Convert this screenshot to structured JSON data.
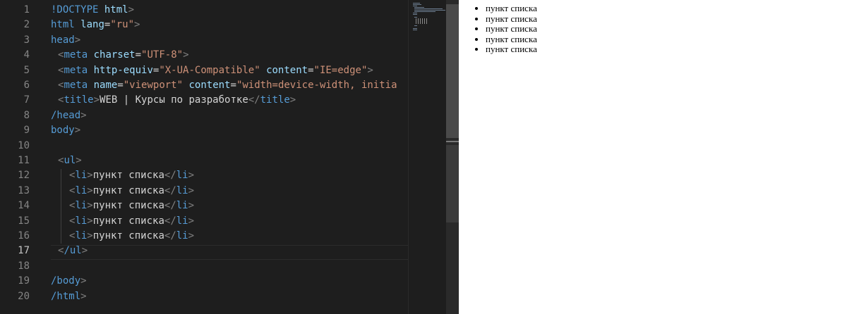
{
  "editor": {
    "active_line": 17,
    "line_numbers": [
      "1",
      "2",
      "3",
      "4",
      "5",
      "6",
      "7",
      "8",
      "9",
      "10",
      "11",
      "12",
      "13",
      "14",
      "15",
      "16",
      "17",
      "18",
      "19",
      "20"
    ],
    "code": {
      "l1": {
        "tag": "!DOCTYPE",
        "attr": "html"
      },
      "l2": {
        "tag": "html",
        "attr": "lang",
        "val": "\"ru\""
      },
      "l3": {
        "tag": "head"
      },
      "l4": {
        "tag": "meta",
        "attr": "charset",
        "val": "\"UTF-8\""
      },
      "l5": {
        "tag": "meta",
        "attr1": "http-equiv",
        "val1": "\"X-UA-Compatible\"",
        "attr2": "content",
        "val2": "\"IE=edge\""
      },
      "l6": {
        "tag": "meta",
        "attr1": "name",
        "val1": "\"viewport\"",
        "attr2": "content",
        "val2": "\"width=device-width, initia"
      },
      "l7": {
        "tag": "title",
        "text": "WEB | Курсы по разработке"
      },
      "l8": {
        "tag": "/head"
      },
      "l9": {
        "tag": "body"
      },
      "l11": {
        "tag": "ul"
      },
      "li_tag": "li",
      "li_text": "пункт списка",
      "l17": {
        "tag": "/ul"
      },
      "l19": {
        "tag": "/body"
      },
      "l20": {
        "tag": "/html"
      }
    }
  },
  "preview": {
    "items": [
      "пункт списка",
      "пункт списка",
      "пункт списка",
      "пункт списка",
      "пункт списка"
    ]
  },
  "colors": {
    "editor_bg": "#1e1e1e",
    "tag": "#569cd6",
    "attribute": "#9cdcfe",
    "string": "#ce9178",
    "text": "#d4d4d4",
    "line_number": "#858585"
  }
}
